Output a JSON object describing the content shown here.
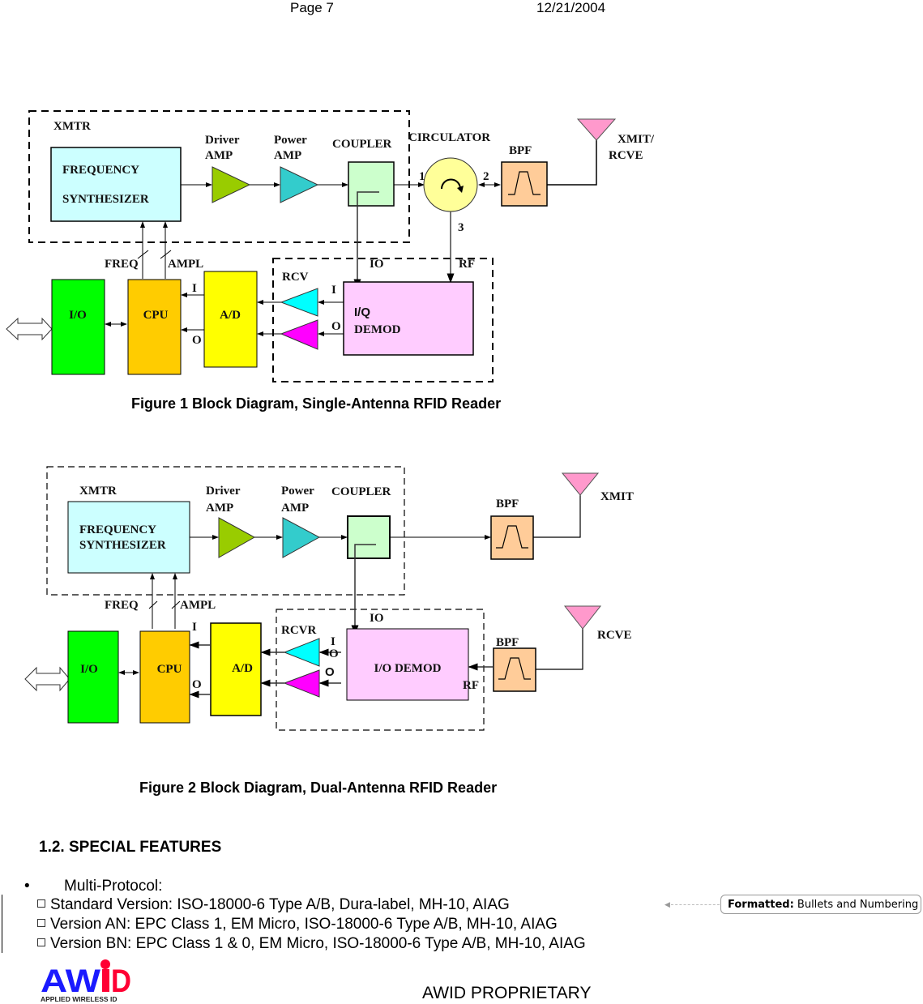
{
  "header": {
    "page": "Page 7",
    "date": "12/21/2004"
  },
  "figure1": {
    "caption": "Figure 1 Block Diagram, Single-Antenna RFID Reader",
    "labels": {
      "xmtr": "XMTR",
      "freq_synth_1": "FREQUENCY",
      "freq_synth_2": "SYNTHESIZER",
      "driver_1": "Driver",
      "driver_2": "AMP",
      "power_1": "Power",
      "power_2": "AMP",
      "coupler": "COUPLER",
      "circulator": "CIRCULATOR",
      "port1": "1",
      "port2": "2",
      "port3": "3",
      "bpf": "BPF",
      "antenna_1": "XMIT/",
      "antenna_2": "RCVE",
      "freq": "FREQ",
      "ampl": "AMPL",
      "io_line": "IO",
      "rf_line": "RF",
      "rcv": "RCV",
      "io_block": "I/O",
      "cpu": "CPU",
      "ad": "A/D",
      "i_cpu": "I",
      "o_cpu": "O",
      "i_demod": "I",
      "o_demod": "O",
      "demod_1": "I/Q",
      "demod_2": "DEMOD"
    }
  },
  "figure2": {
    "caption": "Figure 2 Block Diagram, Dual-Antenna RFID Reader",
    "labels": {
      "xmtr": "XMTR",
      "freq_synth_1": "FREQUENCY",
      "freq_synth_2": "SYNTHESIZER",
      "driver_1": "Driver",
      "driver_2": "AMP",
      "power_1": "Power",
      "power_2": "AMP",
      "coupler": "COUPLER",
      "bpf_tx": "BPF",
      "xmit": "XMIT",
      "bpf_rx": "BPF",
      "rcve": "RCVE",
      "freq": "FREQ",
      "ampl": "AMPL",
      "io_line": "IO",
      "rcvr": "RCVR",
      "io_block": "I/O",
      "cpu": "CPU",
      "ad": "A/D",
      "i_cpu": "I",
      "o_cpu": "O",
      "i_demod": "I",
      "o_demod_a": "O",
      "o_demod_b": "O",
      "demod": "I/O DEMOD",
      "rf": "RF"
    }
  },
  "colors": {
    "synth": "#ccffff",
    "driver": "#99cc00",
    "power": "#33cccc",
    "coupler": "#ccffcc",
    "circulator": "#ffff99",
    "bpf": "#ffcc99",
    "antenna": "#ff99cc",
    "io": "#00ff00",
    "cpu": "#ffcc00",
    "ad": "#ffff00",
    "amp_i": "#00ffff",
    "amp_o": "#ff00ff",
    "demod": "#ffccff"
  },
  "section": {
    "title": "1.2. SPECIAL FEATURES",
    "bullet": "Multi-Protocol:",
    "items": [
      "Standard Version: ISO-18000-6 Type A/B, Dura-label, MH-10, AIAG",
      "Version AN: EPC Class 1, EM Micro, ISO-18000-6 Type A/B, MH-10, AIAG",
      "Version BN: EPC Class 1 & 0, EM Micro, ISO-18000-6 Type A/B, MH-10, AIAG"
    ]
  },
  "comment": {
    "label": "Formatted:",
    "text": "Bullets and Numbering"
  },
  "footer": {
    "logo_text": "AWID",
    "logo_sub": "APPLIED WIRELESS ID",
    "proprietary": "AWID PROPRIETARY"
  }
}
